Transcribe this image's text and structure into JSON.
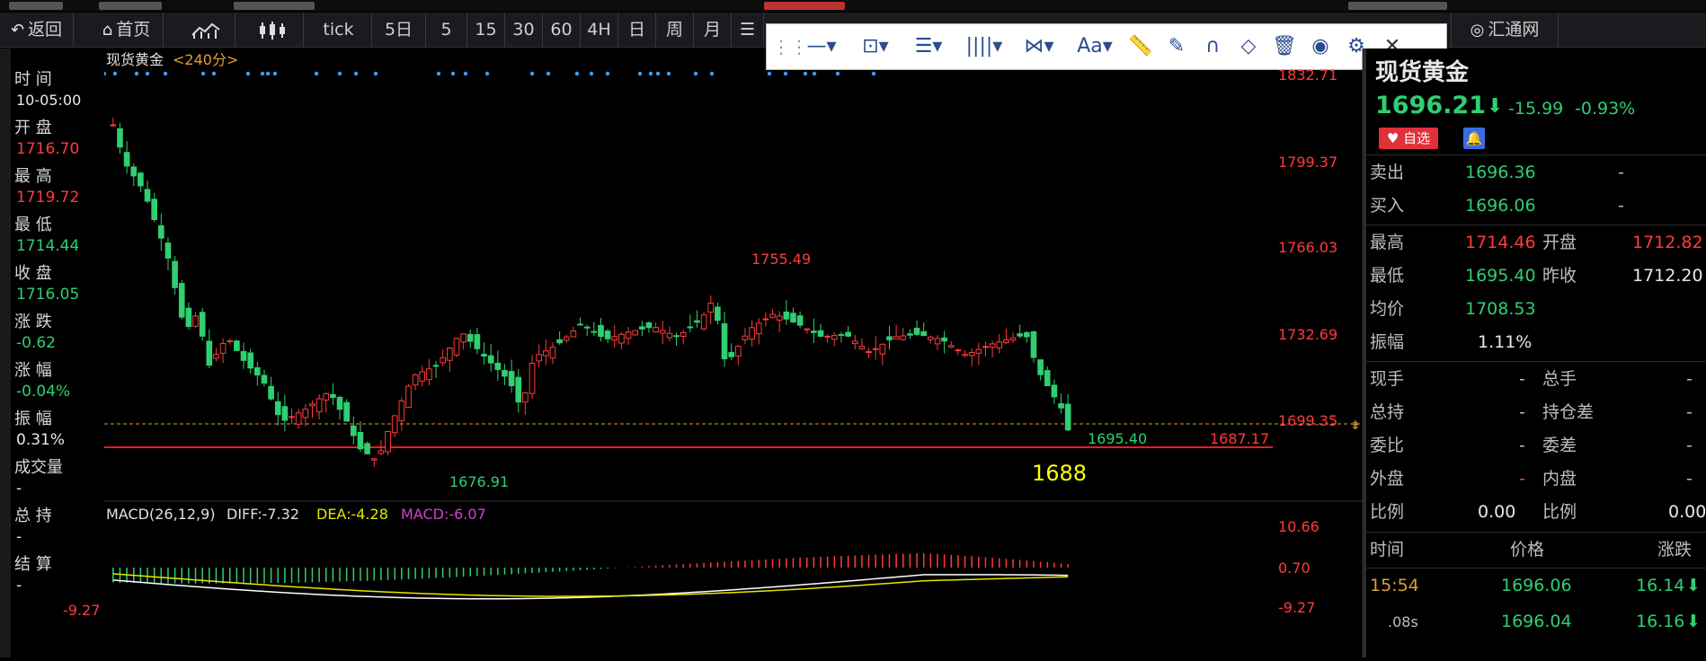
{
  "toolbar": {
    "back": "返回",
    "home": "首页",
    "tick": "tick",
    "periods": [
      "5日",
      "5",
      "15",
      "30",
      "60",
      "4H",
      "日",
      "周",
      "月"
    ],
    "brand": "汇通网"
  },
  "drawbar": {
    "text_tool": "Aa"
  },
  "left": {
    "time_label": "时 间",
    "time_value": "10-05:00",
    "open_label": "开 盘",
    "open_value": "1716.70",
    "high_label": "最 高",
    "high_value": "1719.72",
    "low_label": "最 低",
    "low_value": "1714.44",
    "close_label": "收 盘",
    "close_value": "1716.05",
    "change_label": "涨 跌",
    "change_value": "-0.62",
    "pct_label": "涨 幅",
    "pct_value": "-0.04%",
    "amp_label": "振 幅",
    "amp_value": "0.31%",
    "vol_label": "成交量",
    "vol_value": "-",
    "hold_label": "总 持",
    "hold_value": "-",
    "settle_label": "结 算",
    "settle_value": "-"
  },
  "chart": {
    "title": "现货黄金",
    "period": "<240分>",
    "price_axis": [
      "1832.71",
      "1799.37",
      "1766.03",
      "1732.69",
      "1699.35"
    ],
    "marker_high": "1755.49",
    "marker_low": "1676.91",
    "marker_last": "1695.40",
    "support_value": "1687.17",
    "support_note": "1688",
    "macd_label": "MACD(26,12,9)",
    "diff_label": "DIFF:-7.32",
    "dea_label": "DEA:-4.28",
    "macd_value_label": "MACD:-6.07",
    "macd_axis": [
      "10.66",
      "0.70",
      "-9.27"
    ],
    "macd_left_value": "-9.27",
    "colors": {
      "up": "#ff3b3b",
      "down": "#2fcf72",
      "diff": "#ffffff",
      "dea": "#e6e600",
      "macd": "#d040d0"
    }
  },
  "chart_data": {
    "type": "candlestick",
    "title": "现货黄金 <240分>",
    "ylim": [
      1676.0,
      1833.0
    ],
    "notable": {
      "high": 1755.49,
      "low": 1676.91,
      "last": 1695.4,
      "support_line": 1687.17
    }
  },
  "quote": {
    "symbol": "现货黄金",
    "price": "1696.21",
    "change": "-15.99",
    "pct": "-0.93%",
    "watch_label": "自选",
    "sell_label": "卖出",
    "sell_value": "1696.36",
    "sell_dash": "-",
    "buy_label": "买入",
    "buy_value": "1696.06",
    "buy_dash": "-",
    "high_label": "最高",
    "high_value": "1714.46",
    "open_label": "开盘",
    "open_value": "1712.82",
    "low_label": "最低",
    "low_value": "1695.40",
    "prev_label": "昨收",
    "prev_value": "1712.20",
    "avg_label": "均价",
    "avg_value": "1708.53",
    "amp_label": "振幅",
    "amp_value": "1.11%",
    "now_hand_label": "现手",
    "now_hand_value": "-",
    "total_hand_label": "总手",
    "total_hand_value": "-",
    "total_hold_label": "总持",
    "total_hold_value": "-",
    "hold_diff_label": "持仓差",
    "hold_diff_value": "-",
    "weibi_label": "委比",
    "weibi_value": "-",
    "weicha_label": "委差",
    "weicha_value": "-",
    "outer_label": "外盘",
    "outer_value": "-",
    "inner_label": "内盘",
    "inner_value": "-",
    "ratio_label": "比例",
    "ratio_value": "0.00",
    "ratio2_label": "比例",
    "ratio2_value": "0.00"
  },
  "ticks": {
    "headers": [
      "时间",
      "价格",
      "涨跌"
    ],
    "rows": [
      {
        "time": "15:54",
        "price": "1696.06",
        "chg": "16.14"
      },
      {
        "time": ".08s",
        "price": "1696.04",
        "chg": "16.16"
      }
    ]
  }
}
